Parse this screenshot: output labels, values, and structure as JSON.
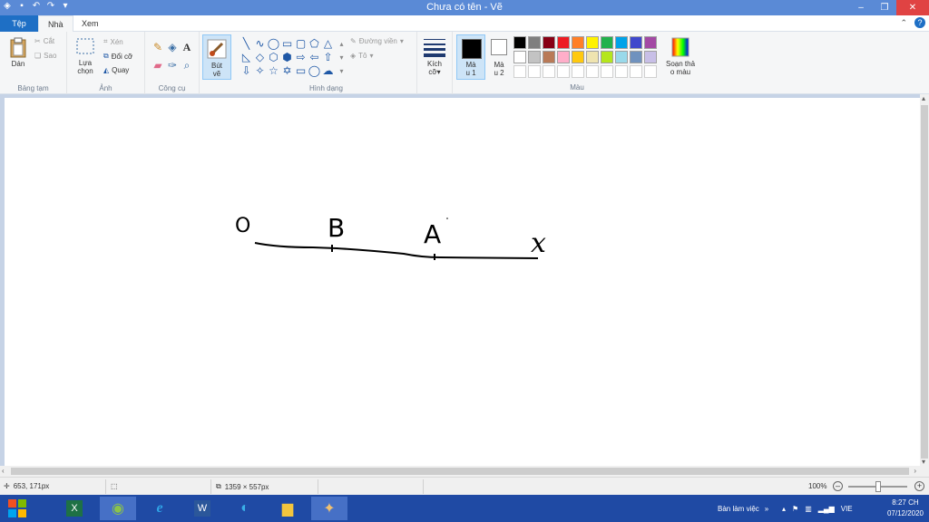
{
  "window": {
    "title": "Chưa có tên - Vẽ"
  },
  "tabs": {
    "file": "Tệp",
    "home": "Nhà",
    "view": "Xem"
  },
  "ribbon": {
    "clipboard": {
      "paste": "Dán",
      "cut": "Cắt",
      "copy": "Sao",
      "group": "Bảng tạm"
    },
    "image": {
      "select_line1": "Lựa",
      "select_line2": "chọn",
      "crop": "Xén",
      "resize": "Đổi cỡ",
      "rotate": "Quay",
      "group": "Ảnh"
    },
    "tools": {
      "group": "Công cụ"
    },
    "brushes": {
      "line1": "Bút",
      "line2": "vẽ"
    },
    "shapes": {
      "outline": "Đường viền",
      "fill": "Tô",
      "group": "Hình dạng"
    },
    "size": {
      "line1": "Kích",
      "line2": "cỡ"
    },
    "colors": {
      "color1_line1": "Mà",
      "color1_line2": "u 1",
      "color2_line1": "Mà",
      "color2_line2": "u 2",
      "edit_line1": "Soạn thả",
      "edit_line2": "o màu",
      "group": "Màu",
      "palette": [
        "#000000",
        "#7f7f7f",
        "#880015",
        "#ed1c24",
        "#ff7f27",
        "#fff200",
        "#22b14c",
        "#00a2e8",
        "#3f48cc",
        "#a349a4",
        "#ffffff",
        "#c3c3c3",
        "#b97a57",
        "#ffaec9",
        "#ffc90e",
        "#efe4b0",
        "#b5e61d",
        "#99d9ea",
        "#7092be",
        "#c8bfe7"
      ]
    }
  },
  "drawing": {
    "labels": [
      "O",
      "B",
      "A",
      "x"
    ]
  },
  "status": {
    "cursor": "653, 171px",
    "canvas_size": "1359 × 557px",
    "zoom": "100%"
  },
  "taskbar": {
    "desktop": "Bàn làm việc",
    "lang": "VIE",
    "time": "8:27 CH",
    "date": "07/12/2020"
  }
}
